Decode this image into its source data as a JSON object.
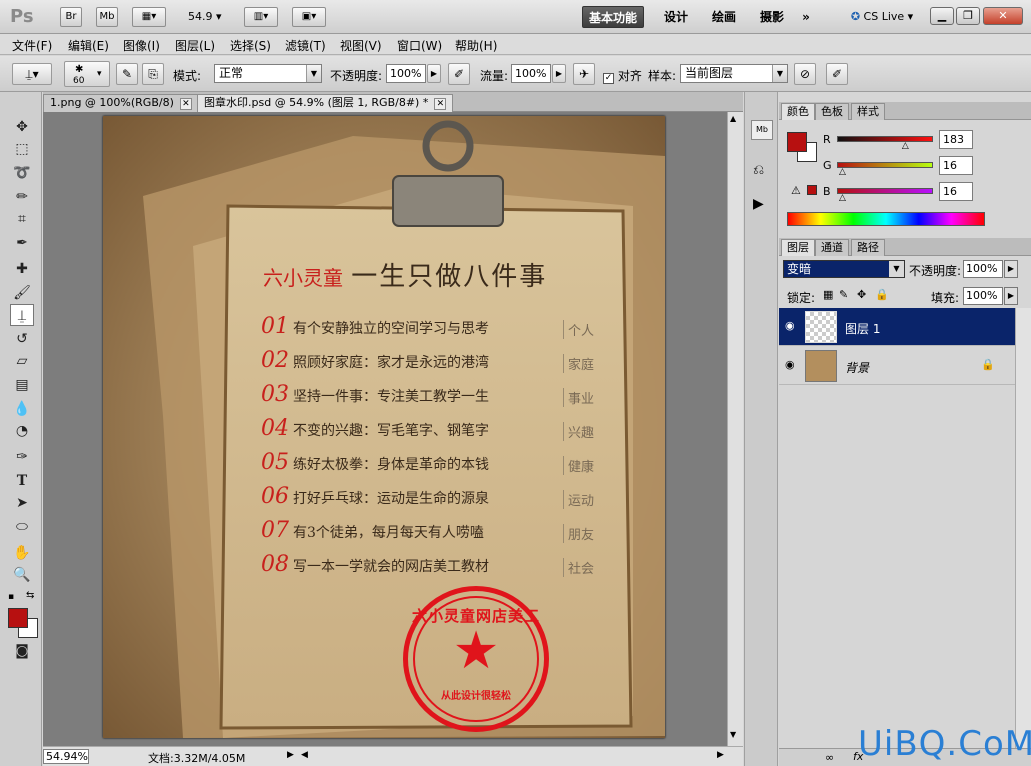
{
  "app": {
    "logo": "Ps",
    "bridge_btn": "Br",
    "minibridge_btn": "Mb",
    "zoom_value": "54.9",
    "workspaces": [
      "基本功能",
      "设计",
      "绘画",
      "摄影"
    ],
    "more": "»",
    "cslive": "CS Live"
  },
  "menu": [
    "文件(F)",
    "编辑(E)",
    "图像(I)",
    "图层(L)",
    "选择(S)",
    "滤镜(T)",
    "视图(V)",
    "窗口(W)",
    "帮助(H)"
  ],
  "options": {
    "brush_size": "60",
    "mode_label": "模式:",
    "mode_value": "正常",
    "opacity_label": "不透明度:",
    "opacity_value": "100%",
    "flow_label": "流量:",
    "flow_value": "100%",
    "align_label": "对齐",
    "sample_label": "样本:",
    "sample_value": "当前图层"
  },
  "tabs": [
    {
      "label": "1.png @ 100%(RGB/8)"
    },
    {
      "label": "图章水印.psd @ 54.9% (图层 1, RGB/8#) *"
    }
  ],
  "canvas": {
    "brand": "六小灵童",
    "headline": "一生只做八件事",
    "items": [
      {
        "num": "01",
        "text": "有个安静独立的空间学习与思考",
        "tag": "个人"
      },
      {
        "num": "02",
        "text": "照顾好家庭：家才是永远的港湾",
        "tag": "家庭"
      },
      {
        "num": "03",
        "text": "坚持一件事：专注美工教学一生",
        "tag": "事业"
      },
      {
        "num": "04",
        "text": "不变的兴趣：写毛笔字、钢笔字",
        "tag": "兴趣"
      },
      {
        "num": "05",
        "text": "练好太极拳：身体是革命的本钱",
        "tag": "健康"
      },
      {
        "num": "06",
        "text": "打好乒乓球：运动是生命的源泉",
        "tag": "运动"
      },
      {
        "num": "07",
        "text": "有3个徒弟，每月每天有人唠嗑",
        "tag": "朋友"
      },
      {
        "num": "08",
        "text": "写一本一学就会的网店美工教材",
        "tag": "社会"
      }
    ],
    "stamp_top": "六小灵童网店美工",
    "stamp_bottom": "从此设计很轻松"
  },
  "status": {
    "zoom": "54.94%",
    "doc": "文档:3.32M/4.05M"
  },
  "color_panel": {
    "tabs": [
      "颜色",
      "色板",
      "样式"
    ],
    "r_label": "R",
    "r_value": "183",
    "r_fraction": 0.718,
    "g_label": "G",
    "g_value": "16",
    "g_fraction": 0.063,
    "b_label": "B",
    "b_value": "16",
    "b_fraction": 0.063,
    "fg_color": "#b71010"
  },
  "layers_panel": {
    "tabs": [
      "图层",
      "通道",
      "路径"
    ],
    "blend_mode": "变暗",
    "opacity_label": "不透明度:",
    "opacity_value": "100%",
    "lock_label": "锁定:",
    "fill_label": "填充:",
    "fill_value": "100%",
    "layers": [
      {
        "name": "图层 1",
        "selected": true
      },
      {
        "name": "背景",
        "selected": false
      }
    ]
  },
  "watermark": "UiBQ.CoM"
}
